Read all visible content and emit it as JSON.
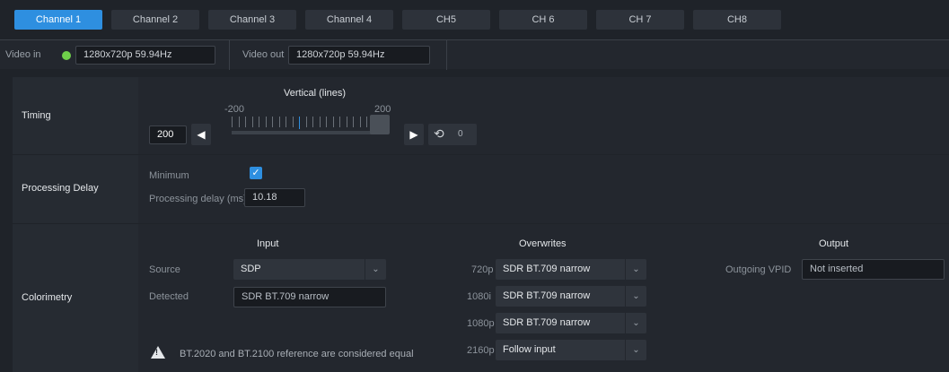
{
  "tabs": [
    {
      "label": "Channel 1",
      "active": true
    },
    {
      "label": "Channel 2"
    },
    {
      "label": "Channel 3"
    },
    {
      "label": "Channel 4"
    },
    {
      "label": "CH5"
    },
    {
      "label": "CH 6"
    },
    {
      "label": "CH 7"
    },
    {
      "label": "CH8"
    }
  ],
  "io": {
    "video_in_label": "Video in",
    "video_in_value": "1280x720p 59.94Hz",
    "video_in_status_color": "#6fcf4a",
    "video_out_label": "Video out",
    "video_out_value": "1280x720p 59.94Hz"
  },
  "timing": {
    "label": "Timing",
    "slider_title": "Vertical (lines)",
    "min_label": "-200",
    "max_label": "200",
    "value": "200",
    "slider_fraction": 1.0,
    "reset_value": "0"
  },
  "processing": {
    "label": "Processing Delay",
    "minimum_label": "Minimum",
    "minimum_checked": true,
    "delay_label": "Processing delay (ms)",
    "delay_value": "10.18"
  },
  "colorimetry": {
    "label": "Colorimetry",
    "input_heading": "Input",
    "overwrites_heading": "Overwrites",
    "output_heading": "Output",
    "source_label": "Source",
    "source_value": "SDP",
    "detected_label": "Detected",
    "detected_value": "SDR BT.709 narrow",
    "warning_text": "BT.2020 and BT.2100 reference are considered equal",
    "overwrites": [
      {
        "format": "720p",
        "value": "SDR BT.709 narrow"
      },
      {
        "format": "1080i",
        "value": "SDR BT.709 narrow"
      },
      {
        "format": "1080p",
        "value": "SDR BT.709 narrow"
      },
      {
        "format": "2160p",
        "value": "Follow input"
      }
    ],
    "outgoing_vpid_label": "Outgoing VPID",
    "outgoing_vpid_value": "Not inserted"
  }
}
